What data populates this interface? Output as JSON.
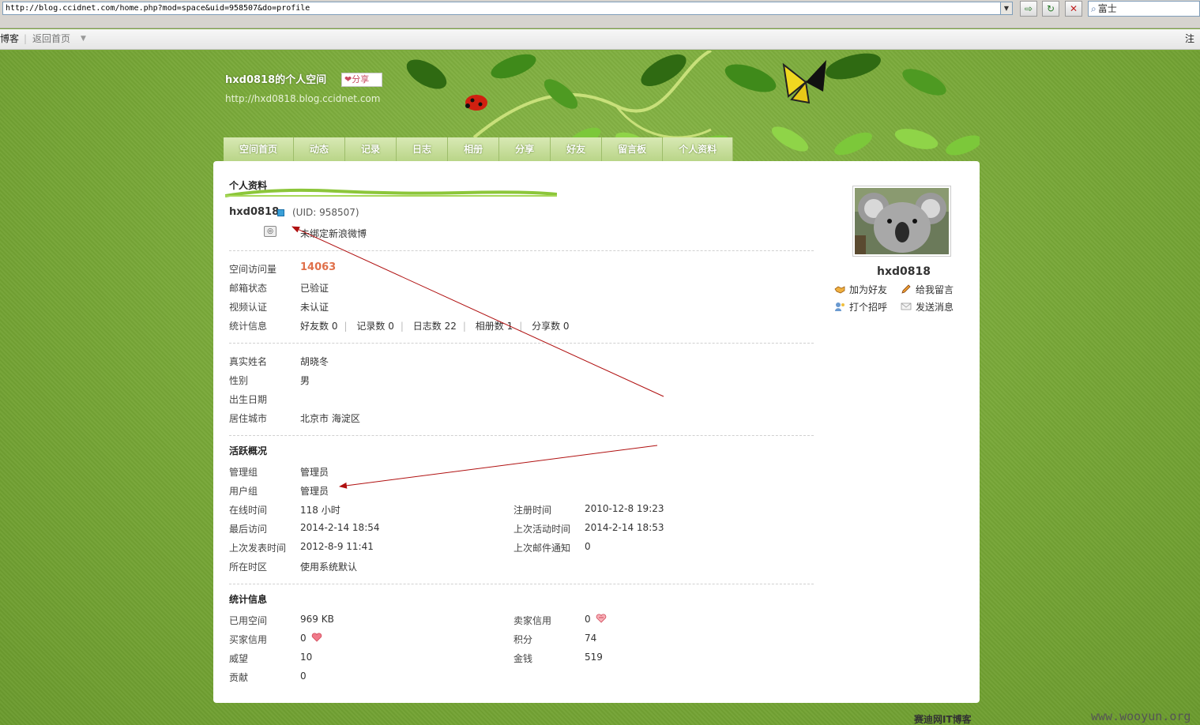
{
  "browser": {
    "url": "http://blog.ccidnet.com/home.php?mod=space&uid=958507&do=profile",
    "search_text": "富士",
    "nav_blog": "博客",
    "nav_home": "返回首页",
    "nav_register": "注册"
  },
  "header": {
    "title": "hxd0818的个人空间",
    "share_label": "分享",
    "url": "http://hxd0818.blog.ccidnet.com"
  },
  "tabs": [
    "空间首页",
    "动态",
    "记录",
    "日志",
    "相册",
    "分享",
    "好友",
    "留言板",
    "个人资料"
  ],
  "profile": {
    "section_title": "个人资料",
    "username": "hxd0818",
    "uid_text": "(UID: 958507)",
    "weibo_text": "未绑定新浪微博",
    "basic": [
      {
        "label": "空间访问量",
        "value": "14063"
      },
      {
        "label": "邮箱状态",
        "value": "已验证"
      },
      {
        "label": "视频认证",
        "value": "未认证"
      }
    ],
    "stats_label": "统计信息",
    "stats": [
      {
        "label": "好友数",
        "value": "0"
      },
      {
        "label": "记录数",
        "value": "0"
      },
      {
        "label": "日志数",
        "value": "22"
      },
      {
        "label": "相册数",
        "value": "1"
      },
      {
        "label": "分享数",
        "value": "0"
      }
    ],
    "personal": [
      {
        "label": "真实姓名",
        "value": "胡晓冬"
      },
      {
        "label": "性别",
        "value": "男"
      },
      {
        "label": "出生日期",
        "value": ""
      },
      {
        "label": "居住城市",
        "value": "北京市 海淀区"
      }
    ],
    "activity_title": "活跃概况",
    "groups": [
      {
        "label": "管理组",
        "value": "管理员"
      },
      {
        "label": "用户组",
        "value": "管理员"
      }
    ],
    "activity_left": [
      {
        "label": "在线时间",
        "value": "118 小时"
      },
      {
        "label": "最后访问",
        "value": "2014-2-14 18:54"
      },
      {
        "label": "上次发表时间",
        "value": "2012-8-9 11:41"
      },
      {
        "label": "所在时区",
        "value": "使用系统默认"
      }
    ],
    "activity_right": [
      {
        "label": "注册时间",
        "value": "2010-12-8 19:23"
      },
      {
        "label": "上次活动时间",
        "value": "2014-2-14 18:53"
      },
      {
        "label": "上次邮件通知",
        "value": "0"
      }
    ],
    "stat_title": "统计信息",
    "stat_left": [
      {
        "label": "已用空间",
        "value": "969 KB"
      },
      {
        "label": "买家信用",
        "value": "0"
      },
      {
        "label": "威望",
        "value": "10"
      },
      {
        "label": "贡献",
        "value": "0"
      }
    ],
    "stat_right": [
      {
        "label": "卖家信用",
        "value": "0"
      },
      {
        "label": "积分",
        "value": "74"
      },
      {
        "label": "金钱",
        "value": "519"
      }
    ]
  },
  "sidebar": {
    "name": "hxd0818",
    "actions": [
      "加为好友",
      "给我留言",
      "打个招呼",
      "发送消息"
    ]
  },
  "footer": {
    "text": "赛迪网IT博客",
    "watermark": "www.wooyun.org"
  },
  "colors": {
    "background_green": "#7aa83a",
    "visit_count": "#e0704a",
    "arrow": "#b01010"
  }
}
